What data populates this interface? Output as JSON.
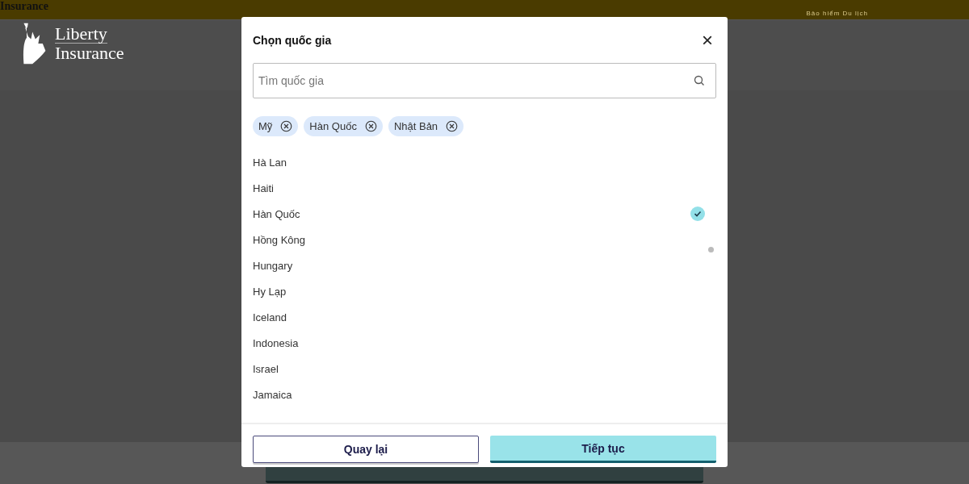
{
  "top_bar": {
    "brand_fragment": "Insurance",
    "tagline": "Bảo hiểm Du lịch"
  },
  "logo": {
    "line_1": "Liberty",
    "line_2": "Insurance"
  },
  "dialog": {
    "title": "Chọn quốc gia",
    "close": "×",
    "search": {
      "placeholder": "Tìm quốc gia"
    },
    "chips": [
      {
        "label": "Mỹ"
      },
      {
        "label": "Hàn Quốc"
      },
      {
        "label": "Nhật Bản"
      }
    ],
    "countries": [
      {
        "label": "Hà Lan",
        "selected": false
      },
      {
        "label": "Haiti",
        "selected": false
      },
      {
        "label": "Hàn Quốc",
        "selected": true
      },
      {
        "label": "Hồng Kông",
        "selected": false
      },
      {
        "label": "Hungary",
        "selected": false
      },
      {
        "label": "Hy Lạp",
        "selected": false
      },
      {
        "label": "Iceland",
        "selected": false
      },
      {
        "label": "Indonesia",
        "selected": false
      },
      {
        "label": "Israel",
        "selected": false
      },
      {
        "label": "Jamaica",
        "selected": false
      }
    ],
    "buttons": [
      {
        "label": "Quay lại",
        "kind": "secondary"
      },
      {
        "label": "Tiếp tục",
        "kind": "primary"
      }
    ]
  }
}
